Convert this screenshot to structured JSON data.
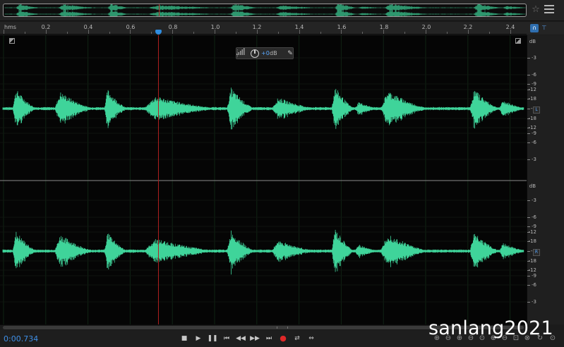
{
  "ruler": {
    "unit": "hms",
    "ticks": [
      "0.2",
      "0.4",
      "0.6",
      "0.8",
      "1.0",
      "1.2",
      "1.4",
      "1.6",
      "1.8",
      "2.0",
      "2.2",
      "2.4"
    ]
  },
  "hud": {
    "value": "+0",
    "unit": "dB"
  },
  "db_scale": {
    "unit": "dB",
    "labels": [
      "-3",
      "-6",
      "-9",
      "-12",
      "-18",
      "-∞",
      "-18",
      "-12",
      "-9",
      "-6",
      "-3"
    ],
    "channels": [
      "L",
      "R"
    ]
  },
  "transport": {
    "timecode": "0:00.734",
    "buttons": [
      {
        "name": "stop-button",
        "icon": "■"
      },
      {
        "name": "play-button",
        "icon": "▶"
      },
      {
        "name": "pause-button",
        "icon": "❚❚"
      },
      {
        "name": "go-to-start-button",
        "icon": "⏮"
      },
      {
        "name": "rewind-button",
        "icon": "◀◀"
      },
      {
        "name": "fast-forward-button",
        "icon": "▶▶"
      },
      {
        "name": "go-to-end-button",
        "icon": "⏭"
      },
      {
        "name": "record-button",
        "icon": "●"
      },
      {
        "name": "loop-button",
        "icon": "⇄"
      },
      {
        "name": "skip-button",
        "icon": "⇔"
      }
    ]
  },
  "watermark": "sanlang2021",
  "colors": {
    "waveform": "#3fd49a",
    "playhead": "#b02020",
    "accent": "#2f8de0",
    "timecode": "#3f8fe6"
  },
  "playhead_time": 0.734
}
